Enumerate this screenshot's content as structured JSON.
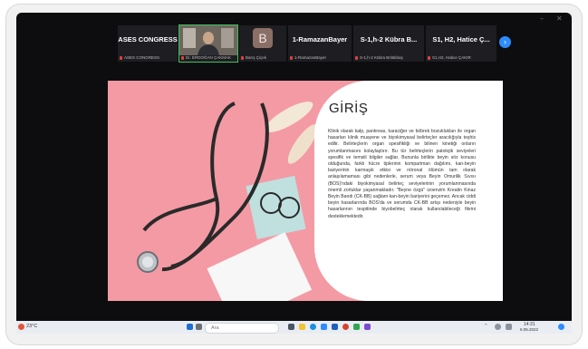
{
  "participants": {
    "tiles": [
      {
        "title": "ASES CONGRESS",
        "name": "ASES CONGRESS"
      },
      {
        "title": "",
        "name": "Dr. ERDOĞAN ÇAKMAK"
      },
      {
        "title": "B",
        "name": "Barış Çiçek"
      },
      {
        "title": "1-RamazanBayer",
        "name": "1-RamazanBayer"
      },
      {
        "title": "S-1,h-2 Kübra B...",
        "name": "S-1,h-2 Kübra Bölükbaş"
      },
      {
        "title": "S1, H2, Hatice Ç...",
        "name": "S1,H2, Hatice ÇAKIR"
      }
    ],
    "next_label": "›"
  },
  "slide": {
    "title": "GİRİŞ",
    "body": "Klinik olarak kalp, pankreas, karaciğer ve böbrek bozuklukları ile organ hasarları klinik muayene ve biyokimyasal belirteçler aracılığıyla teşhis edilir. Belirteçlerin organ spesifikliği ve bilinen kinetiği onların yorumlanmasını kolaylaştırır. Bu tür belirteçlerin patolojik seviyeleri spesifik ve temsili bilgiler sağlar. Bununla birlikte beyin söz konusu olduğunda, farklı hücre tiplerinin kompartman dağılımı, kan-beyin bariyerinin karmaşık etkisi ve nöronal ölümün tam olarak anlaşılamaması gibi nedenlerle, serum veya Beyin Omurilik Sıvısı (BOS)'ndaki biyokimyasal belirteç seviyelerinin yorumlanmasında önemli zorluklar yaşanmaktadır. \"Beyne özgü\" izoenzim Kreatin Kinaz Beyin Bandı (CK-BB) sağlam kan-beyin bariyerini geçemez. Ancak ciddi beyin hasarlarında BOS'da ve serumda CK-BB artışı nedeniyle beyin hasarlarının tespitinde biyobelirteç olarak kullanılabileceği fikrini desteklemektedir."
  },
  "taskbar": {
    "weather": "23°C",
    "search_placeholder": "Ara",
    "time": "14:31",
    "date": "6.05.2022"
  },
  "colors": {
    "slide_pink": "#f49aa4",
    "active_speaker": "#3dc45a",
    "zoom_blue": "#2d8cff"
  }
}
